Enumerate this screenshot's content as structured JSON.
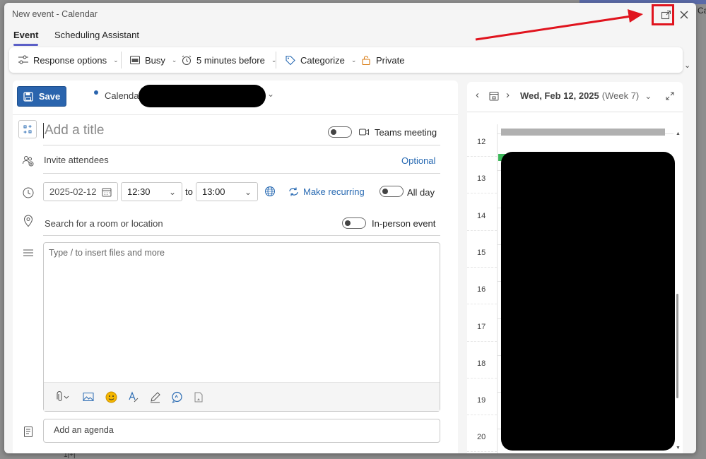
{
  "window": {
    "title": "New event - Calendar",
    "background_snippet": "Ca",
    "background_bottom_snippet": "1|+|"
  },
  "tabs": [
    {
      "label": "Event",
      "active": true
    },
    {
      "label": "Scheduling Assistant",
      "active": false
    }
  ],
  "toolbar": {
    "response_options": "Response options",
    "busy": "Busy",
    "reminder": "5 minutes before",
    "categorize": "Categorize",
    "private": "Private"
  },
  "form": {
    "save_label": "Save",
    "calendar_label": "Calendar",
    "title_placeholder": "Add a title",
    "teams_meeting_label": "Teams meeting",
    "attendees_placeholder": "Invite attendees",
    "optional_label": "Optional",
    "start_date": "2025-02-12",
    "start_time": "12:30",
    "to_label": "to",
    "end_time": "13:00",
    "make_recurring_label": "Make recurring",
    "all_day_label": "All day",
    "location_placeholder": "Search for a room or location",
    "in_person_label": "In-person event",
    "body_placeholder": "Type / to insert files and more",
    "agenda_placeholder": "Add an agenda"
  },
  "calendar_preview": {
    "date": "Wed, Feb 12, 2025",
    "week": "(Week 7)",
    "hours": [
      "12",
      "13",
      "14",
      "15",
      "16",
      "17",
      "18",
      "19",
      "20"
    ]
  },
  "colors": {
    "accent": "#2a64ad",
    "tab_indicator": "#5b5fc7",
    "annotation_red": "#e0141e",
    "event_green": "#3cb85a"
  },
  "icons": {
    "popout": "popout-icon",
    "close": "close-icon"
  }
}
